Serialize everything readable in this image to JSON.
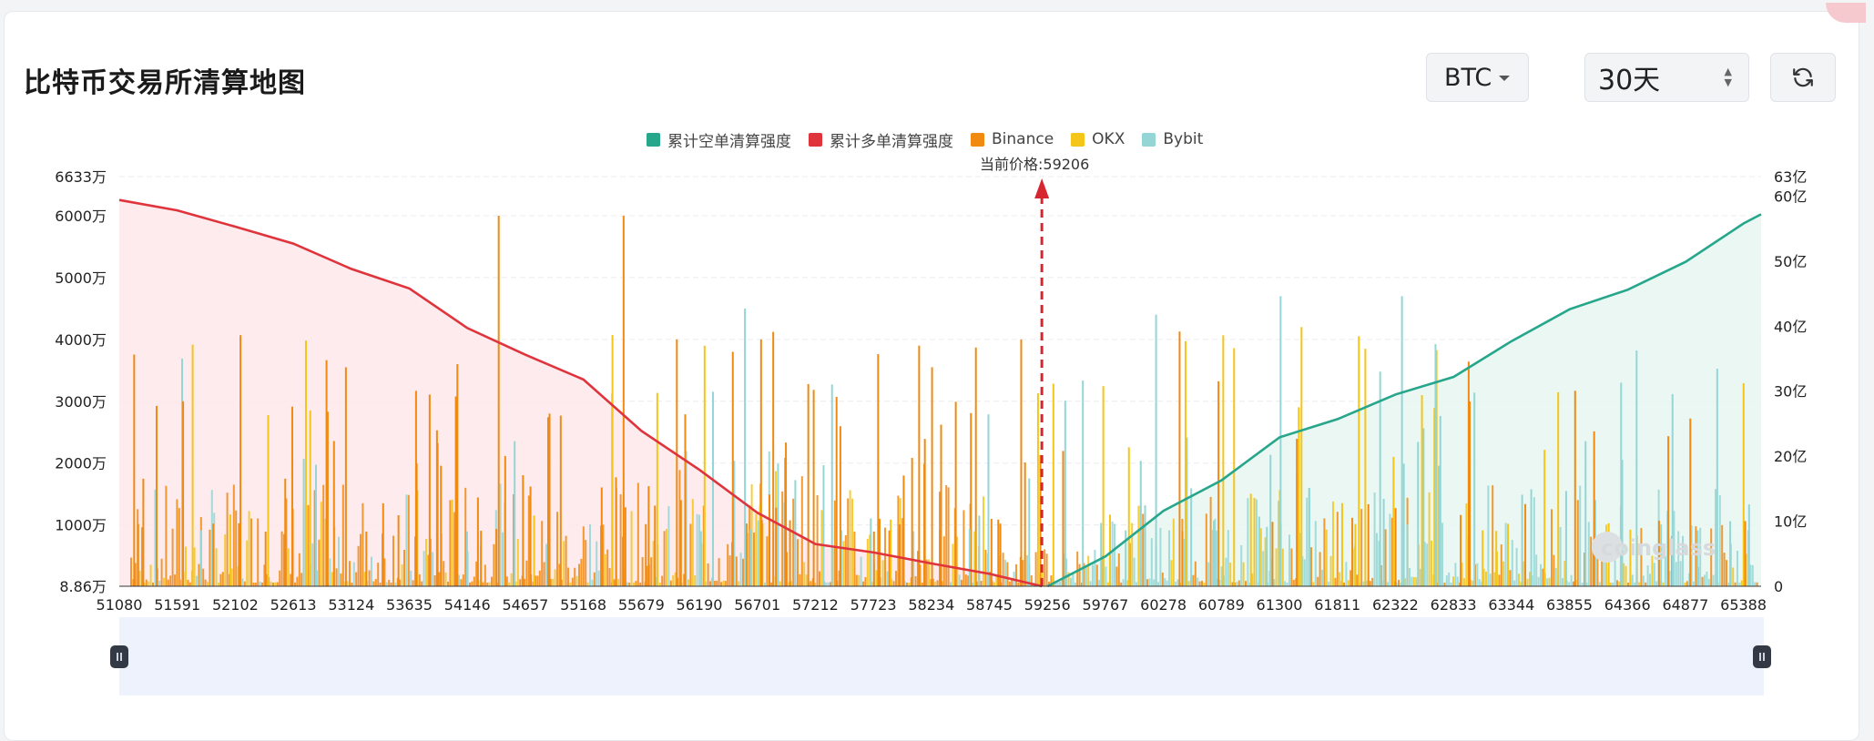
{
  "title": "比特币交易所清算地图",
  "controls": {
    "coin_select": "BTC",
    "range_select": "30天",
    "refresh_icon": "refresh-icon"
  },
  "colors": {
    "short_cumulative": "#26a68b",
    "long_cumulative": "#e0343d",
    "binance": "#f08a10",
    "okx": "#f5c518",
    "bybit": "#94d6d6",
    "short_fill": "#e7f6f0",
    "long_fill": "#fde8ea",
    "current_price_line": "#d62630"
  },
  "chart_data": {
    "type": "bar",
    "legend": [
      "累计空单清算强度",
      "累计多单清算强度",
      "Binance",
      "OKX",
      "Bybit"
    ],
    "legend_position": "top-center",
    "current_price_label": "当前价格:59206",
    "current_price": 59206,
    "x_tick_labels": [
      "51080",
      "51591",
      "52102",
      "52613",
      "53124",
      "53635",
      "54146",
      "54657",
      "55168",
      "55679",
      "56190",
      "56701",
      "57212",
      "57723",
      "58234",
      "58745",
      "59256",
      "59767",
      "60278",
      "60789",
      "61300",
      "61811",
      "62322",
      "62833",
      "63344",
      "63855",
      "64366",
      "64877",
      "65388"
    ],
    "xlim": [
      51080,
      65541
    ],
    "y_left_ticks": [
      "8.86万",
      "1000万",
      "2000万",
      "3000万",
      "4000万",
      "5000万",
      "6000万",
      "6633万"
    ],
    "y_left_values": [
      88600,
      10000000,
      20000000,
      30000000,
      40000000,
      50000000,
      60000000,
      66330000
    ],
    "y_right_ticks": [
      "0",
      "10亿",
      "20亿",
      "30亿",
      "40亿",
      "50亿",
      "60亿",
      "63亿"
    ],
    "y_right_values": [
      0,
      10,
      20,
      30,
      40,
      50,
      60,
      63
    ],
    "ylim_left": [
      88600,
      66330000
    ],
    "ylim_right": [
      0,
      63
    ],
    "grid": true,
    "long_cumulative": {
      "x": [
        51080,
        51591,
        52102,
        52613,
        53124,
        53635,
        54146,
        54657,
        55168,
        55679,
        56190,
        56701,
        57212,
        57723,
        58234,
        58745,
        59206
      ],
      "y": [
        59.4,
        57.8,
        55.3,
        52.7,
        48.8,
        45.8,
        39.7,
        35.6,
        31.8,
        23.9,
        17.9,
        11.3,
        6.5,
        5.2,
        3.5,
        1.9,
        0
      ]
    },
    "short_cumulative": {
      "x": [
        59256,
        59767,
        60278,
        60789,
        61300,
        61811,
        62322,
        62833,
        63344,
        63855,
        64366,
        64877,
        65388,
        65541
      ],
      "y": [
        0,
        4.6,
        11.6,
        16.3,
        22.9,
        25.7,
        29.5,
        32.2,
        37.7,
        42.6,
        45.6,
        49.9,
        55.8,
        57.2
      ]
    },
    "bars": {
      "binance_peaks": [
        {
          "x": 51634,
          "y": 30000000
        },
        {
          "x": 53068,
          "y": 35500000
        },
        {
          "x": 54050,
          "y": 36000000
        },
        {
          "x": 54414,
          "y": 60000000
        },
        {
          "x": 55514,
          "y": 60000000
        },
        {
          "x": 55983,
          "y": 40000000
        },
        {
          "x": 56476,
          "y": 38000000
        },
        {
          "x": 56725,
          "y": 40000000
        },
        {
          "x": 58117,
          "y": 39000000
        },
        {
          "x": 59016,
          "y": 40000000
        }
      ],
      "bybit_peaks": [
        {
          "x": 56583,
          "y": 45000000
        },
        {
          "x": 60204,
          "y": 44000000
        },
        {
          "x": 61301,
          "y": 47000000
        },
        {
          "x": 62370,
          "y": 47000000
        },
        {
          "x": 64300,
          "y": 33000000
        }
      ],
      "okx_peaks": [
        {
          "x": 61485,
          "y": 42000000
        },
        {
          "x": 62546,
          "y": 31000000
        }
      ]
    }
  }
}
